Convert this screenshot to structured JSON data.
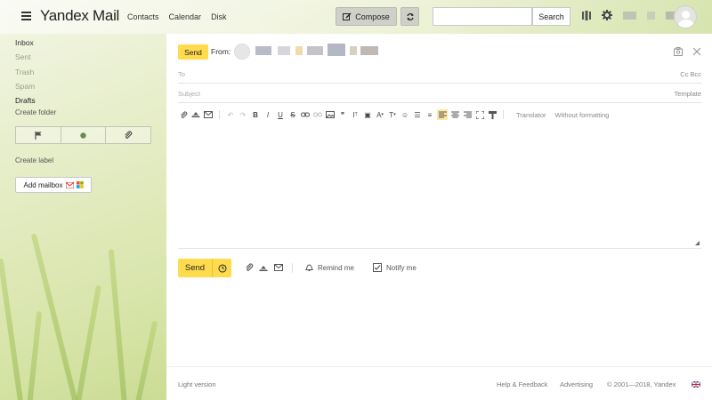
{
  "header": {
    "logo": "Yandex",
    "logo_suffix": "Mail",
    "nav": [
      "Contacts",
      "Calendar",
      "Disk"
    ],
    "compose_label": "Compose",
    "search_button": "Search",
    "search_value": ""
  },
  "sidebar": {
    "folders": [
      {
        "label": "Inbox",
        "state": "normal"
      },
      {
        "label": "Sent",
        "state": "dim"
      },
      {
        "label": "Trash",
        "state": "dim"
      },
      {
        "label": "Spam",
        "state": "dim"
      },
      {
        "label": "Drafts",
        "state": "active"
      }
    ],
    "create_folder": "Create folder",
    "create_label": "Create label",
    "add_mailbox": "Add mailbox"
  },
  "compose": {
    "send_label": "Send",
    "from_label": "From:",
    "to_placeholder": "To",
    "cc_bcc": "Cc Bcc",
    "subject_placeholder": "Subject",
    "template_label": "Template",
    "translator": "Translator",
    "without_formatting": "Without formatting",
    "send_bottom": "Send",
    "remind_me": "Remind me",
    "notify_me": "Notify me"
  },
  "footer": {
    "light_version": "Light version",
    "help": "Help & Feedback",
    "advertising": "Advertising",
    "copyright": "© 2001—2018, Yandex"
  },
  "colors": {
    "accent": "#ffdb4d",
    "panel": "#ffffff"
  }
}
